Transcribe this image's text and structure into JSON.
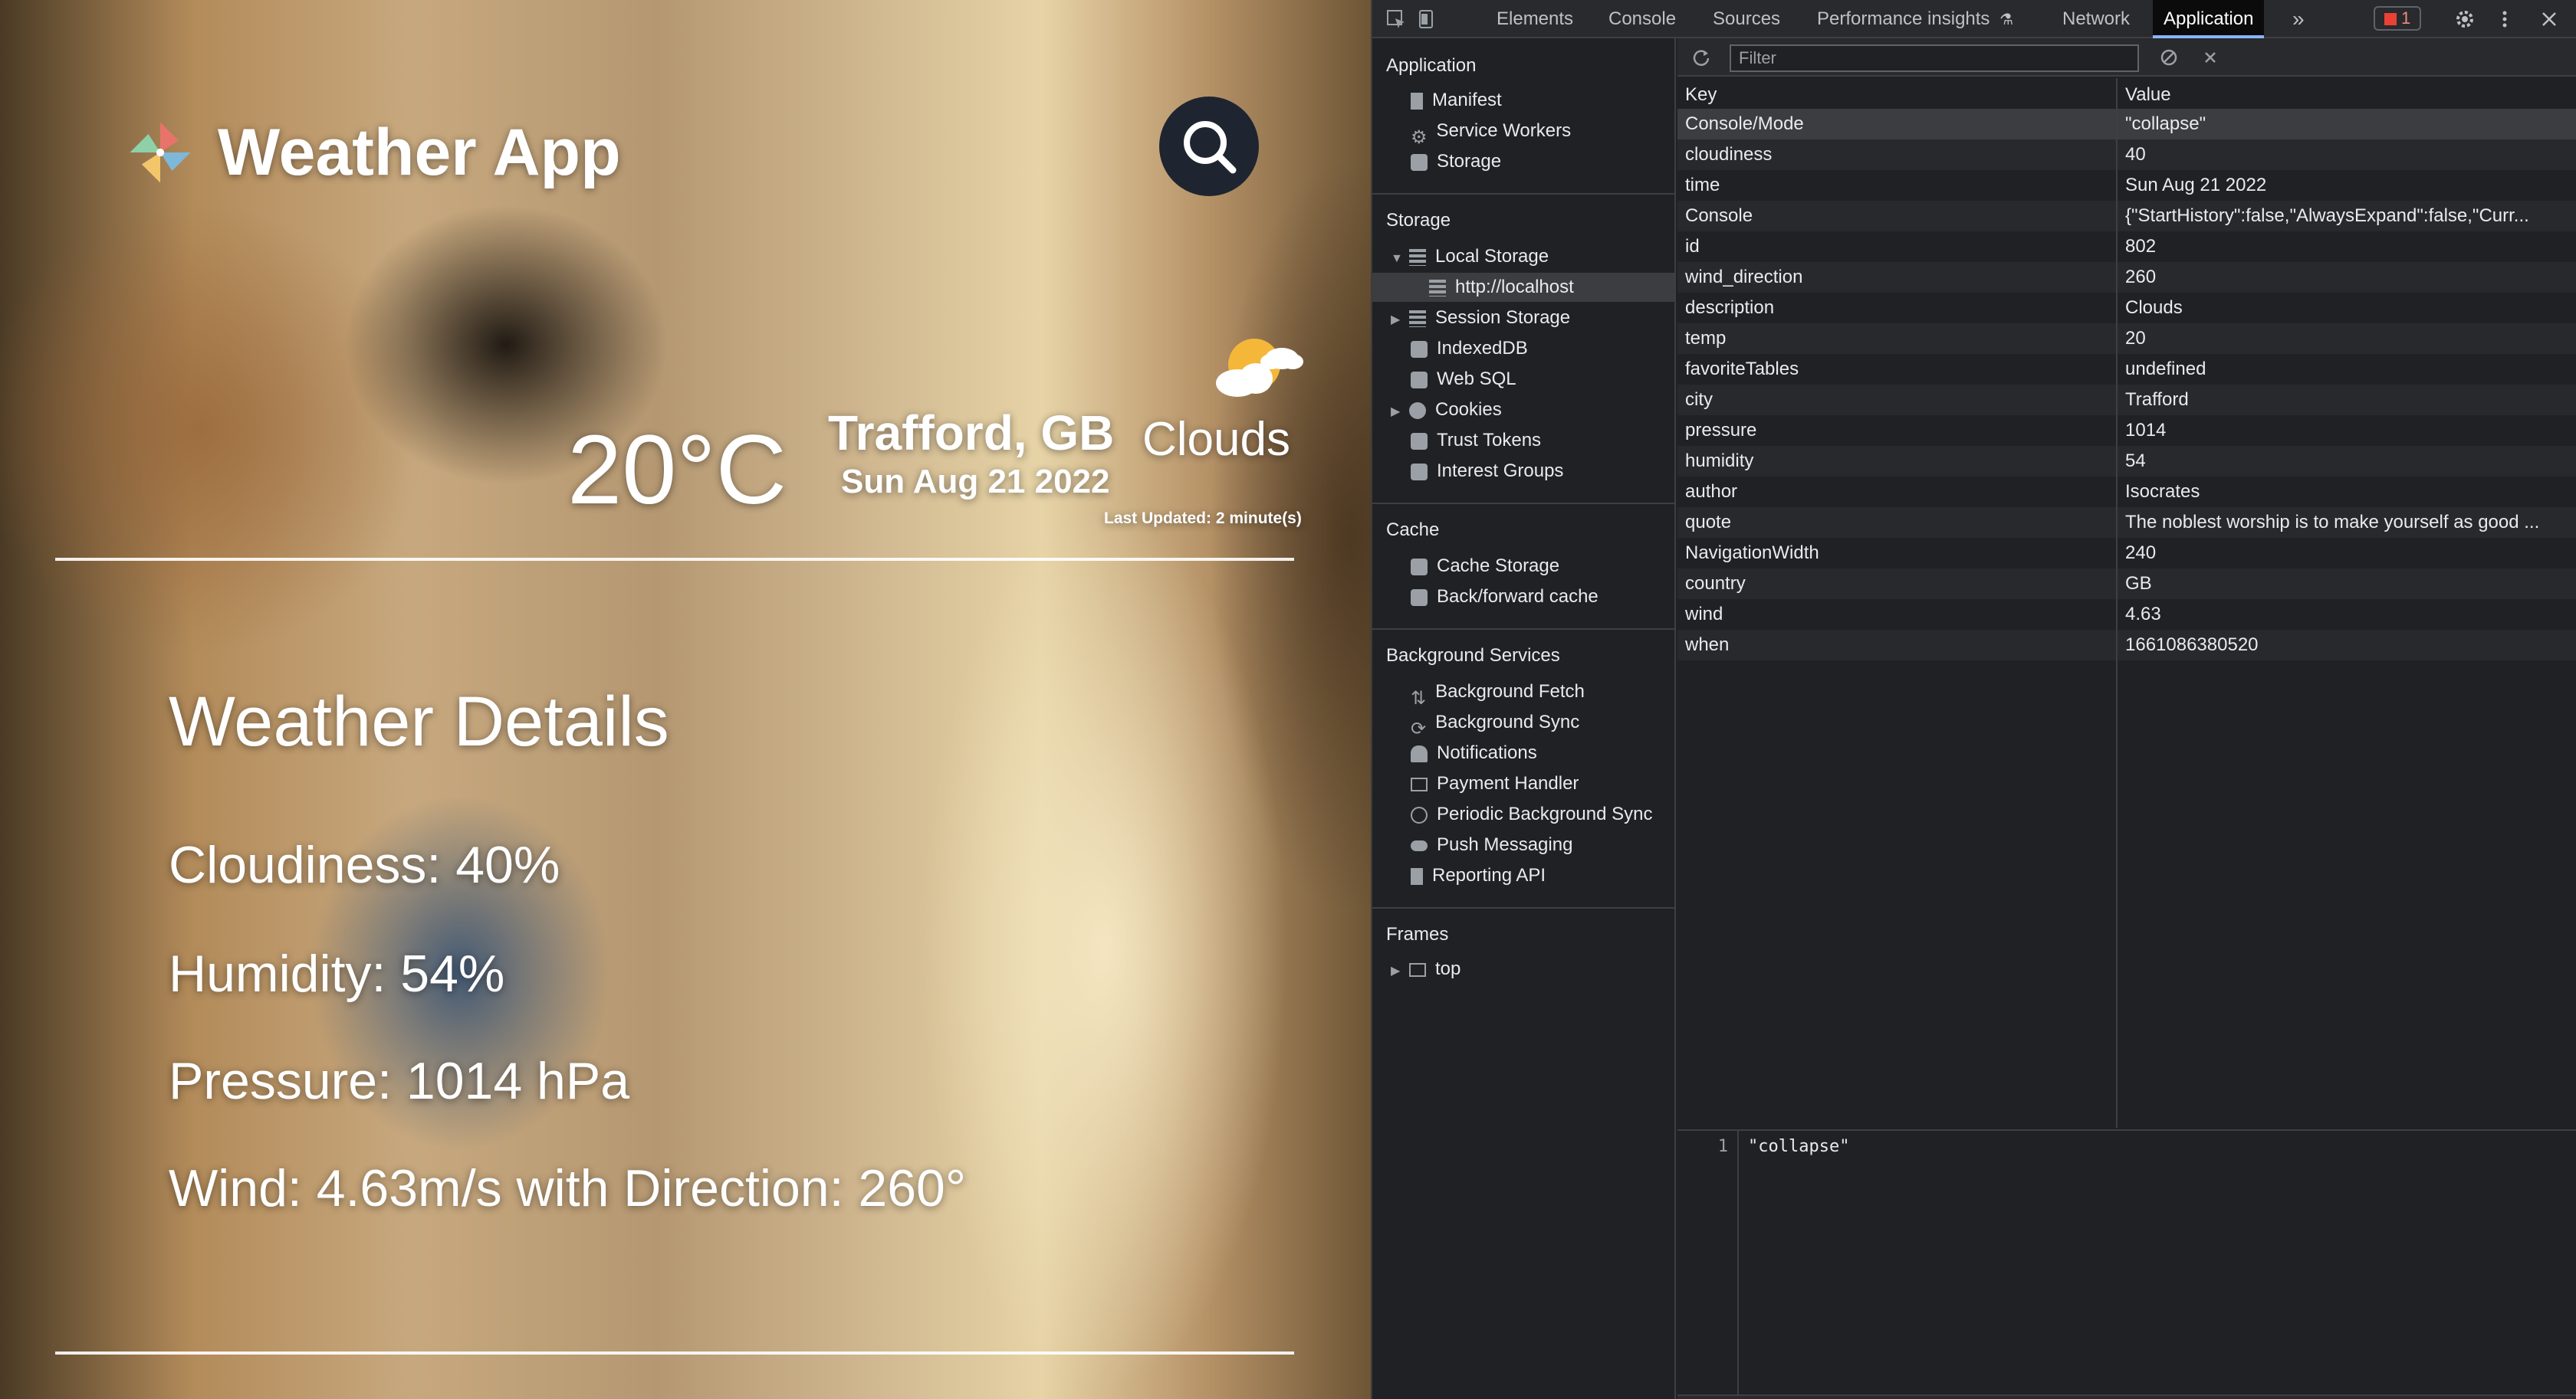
{
  "weather": {
    "app_title": "Weather App",
    "temperature": "20°C",
    "city": "Trafford, GB",
    "date": "Sun Aug 21 2022",
    "description": "Clouds",
    "last_updated": "Last Updated: 2 minute(s)",
    "details_title": "Weather Details",
    "details": [
      "Cloudiness: 40%",
      "Humidity: 54%",
      "Pressure: 1014 hPa",
      "Wind: 4.63m/s with Direction: 260°"
    ]
  },
  "devtools": {
    "tabs": [
      "Elements",
      "Console",
      "Sources",
      "Performance insights",
      "Network",
      "Application"
    ],
    "active_tab": "Application",
    "error_count": "1",
    "sidebar": {
      "application_title": "Application",
      "application_items": [
        "Manifest",
        "Service Workers",
        "Storage"
      ],
      "storage_title": "Storage",
      "storage_items": [
        "Local Storage",
        "http://localhost",
        "Session Storage",
        "IndexedDB",
        "Web SQL",
        "Cookies",
        "Trust Tokens",
        "Interest Groups"
      ],
      "cache_title": "Cache",
      "cache_items": [
        "Cache Storage",
        "Back/forward cache"
      ],
      "background_title": "Background Services",
      "background_items": [
        "Background Fetch",
        "Background Sync",
        "Notifications",
        "Payment Handler",
        "Periodic Background Sync",
        "Push Messaging",
        "Reporting API"
      ],
      "frames_title": "Frames",
      "frames_items": [
        "top"
      ]
    },
    "filter_placeholder": "Filter",
    "table": {
      "key_header": "Key",
      "value_header": "Value",
      "rows": [
        {
          "key": "Console/Mode",
          "value": "\"collapse\""
        },
        {
          "key": "cloudiness",
          "value": "40"
        },
        {
          "key": "time",
          "value": "Sun Aug 21 2022"
        },
        {
          "key": "Console",
          "value": "{\"StartHistory\":false,\"AlwaysExpand\":false,\"Curr..."
        },
        {
          "key": "id",
          "value": "802"
        },
        {
          "key": "wind_direction",
          "value": "260"
        },
        {
          "key": "description",
          "value": "Clouds"
        },
        {
          "key": "temp",
          "value": "20"
        },
        {
          "key": "favoriteTables",
          "value": "undefined"
        },
        {
          "key": "city",
          "value": "Trafford"
        },
        {
          "key": "pressure",
          "value": "1014"
        },
        {
          "key": "humidity",
          "value": "54"
        },
        {
          "key": "author",
          "value": "Isocrates"
        },
        {
          "key": "quote",
          "value": "The noblest worship is to make yourself as good ..."
        },
        {
          "key": "NavigationWidth",
          "value": "240"
        },
        {
          "key": "country",
          "value": "GB"
        },
        {
          "key": "wind",
          "value": "4.63"
        },
        {
          "key": "when",
          "value": "1661086380520"
        }
      ]
    },
    "preview": {
      "line_number": "1",
      "content": "\"collapse\""
    }
  }
}
